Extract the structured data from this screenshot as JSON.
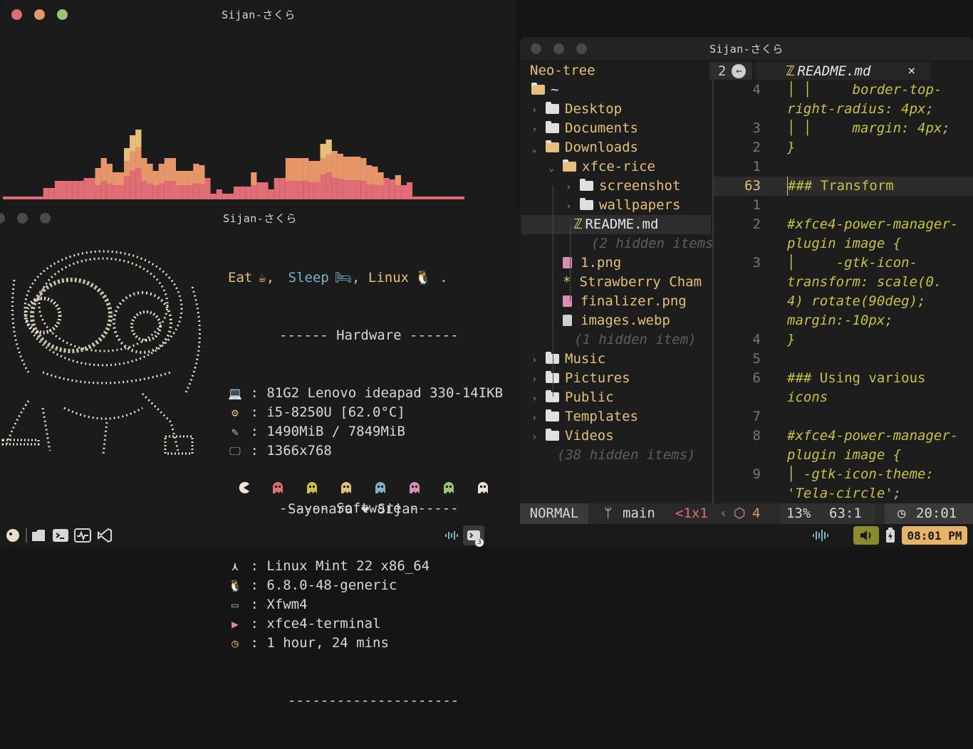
{
  "cava": {
    "title": "Sijan-さくら",
    "dot_colors": [
      "#e06c75",
      "#e5976a",
      "#98c379"
    ]
  },
  "fetch": {
    "title": "Sijan-さくら",
    "tagline": {
      "eat": "Eat",
      "sleep": "Sleep",
      "linux": "Linux",
      "cup_icon": "☕",
      "bed_icon": "🛏",
      "tux_icon": "🐧"
    },
    "hardware_header": "------ Hardware ------",
    "software_header": "------ Software ------",
    "divider": "---------------------",
    "hardware": [
      {
        "icon": "laptop-icon",
        "value": "81G2 Lenovo ideapad 330-14IKB"
      },
      {
        "icon": "cpu-icon",
        "value": "i5-8250U [62.0°C]"
      },
      {
        "icon": "memory-icon",
        "value": "1490MiB / 7849MiB"
      },
      {
        "icon": "monitor-icon",
        "value": "1366x768"
      }
    ],
    "software": [
      {
        "icon": "mint-icon",
        "value": "Linux Mint 22 x86_64"
      },
      {
        "icon": "tux-icon",
        "value": "6.8.0-48-generic"
      },
      {
        "icon": "window-icon",
        "value": "Xfwm4"
      },
      {
        "icon": "terminal-icon",
        "value": "xfce4-terminal"
      },
      {
        "icon": "clock-icon",
        "value": "1 hour, 24 mins"
      }
    ],
    "footer": "Sayonara ❤ Sijan",
    "ghost_colors": [
      "#f0e6d2",
      "#e06c75",
      "#c8c246",
      "#e5c07b",
      "#7fb2c8",
      "#d98fb5",
      "#98c379",
      "#e8e0d0"
    ]
  },
  "nvim": {
    "title": "Sijan-さくら",
    "tree_title": "Neo-tree",
    "buffer_count": "2",
    "tab_file": "README.md",
    "tree": [
      {
        "depth": 0,
        "kind": "root",
        "label": "~"
      },
      {
        "depth": 0,
        "kind": "dir",
        "label": "Desktop"
      },
      {
        "depth": 0,
        "kind": "dir",
        "label": "Documents"
      },
      {
        "depth": 0,
        "kind": "dir-open",
        "label": "Downloads"
      },
      {
        "depth": 1,
        "kind": "dir-open",
        "label": "xfce-rice"
      },
      {
        "depth": 2,
        "kind": "dir",
        "label": "screenshot"
      },
      {
        "depth": 2,
        "kind": "dir",
        "label": "wallpapers"
      },
      {
        "depth": 2,
        "kind": "md",
        "label": "README.md"
      },
      {
        "depth": 2,
        "kind": "hidden",
        "label": "(2 hidden items"
      },
      {
        "depth": 1,
        "kind": "img",
        "label": "1.png"
      },
      {
        "depth": 1,
        "kind": "star",
        "label": "Strawberry Cham"
      },
      {
        "depth": 1,
        "kind": "img",
        "label": "finalizer.png"
      },
      {
        "depth": 1,
        "kind": "img2",
        "label": "images.webp"
      },
      {
        "depth": 1,
        "kind": "hidden",
        "label": "(1 hidden item)"
      },
      {
        "depth": 0,
        "kind": "dir",
        "label": "Music"
      },
      {
        "depth": 0,
        "kind": "dir",
        "label": "Pictures"
      },
      {
        "depth": 0,
        "kind": "dir",
        "label": "Public"
      },
      {
        "depth": 0,
        "kind": "dir",
        "label": "Templates"
      },
      {
        "depth": 0,
        "kind": "dir",
        "label": "Videos"
      },
      {
        "depth": 0,
        "kind": "hidden",
        "label": "(38 hidden items)"
      }
    ],
    "editor_lines": [
      {
        "num": "4",
        "code": "│ │     border-top-"
      },
      {
        "num": "",
        "code": "right-radius: 4px;"
      },
      {
        "num": "3",
        "code": "│ │     margin: 4px;"
      },
      {
        "num": "2",
        "code": "}"
      },
      {
        "num": "1",
        "code": ""
      },
      {
        "num": "63",
        "code": "### Transform",
        "current": true
      },
      {
        "num": "1",
        "code": ""
      },
      {
        "num": "2",
        "code": "#xfce4-power-manager-"
      },
      {
        "num": "",
        "code": "plugin image {"
      },
      {
        "num": "3",
        "code": "│     -gtk-icon-"
      },
      {
        "num": "",
        "code": "transform: scale(0."
      },
      {
        "num": "",
        "code": "4) rotate(90deg);"
      },
      {
        "num": "",
        "code": "margin:-10px;"
      },
      {
        "num": "4",
        "code": "}"
      },
      {
        "num": "5",
        "code": ""
      },
      {
        "num": "6",
        "code": "### Using various"
      },
      {
        "num": "",
        "code": "icons"
      },
      {
        "num": "7",
        "code": ""
      },
      {
        "num": "8",
        "code": "#xfce4-power-manager-"
      },
      {
        "num": "",
        "code": "plugin image {"
      },
      {
        "num": "9",
        "code": "│ -gtk-icon-theme:"
      },
      {
        "num": "",
        "code": "'Tela-circle';"
      }
    ],
    "status": {
      "mode": "NORMAL",
      "branch": "main",
      "diag": "<1x1",
      "pkg": "4",
      "percent": "13%",
      "position": "63:1",
      "time": "20:01"
    }
  },
  "taskbar": {
    "clock": "08:01 PM",
    "badge": "3"
  }
}
